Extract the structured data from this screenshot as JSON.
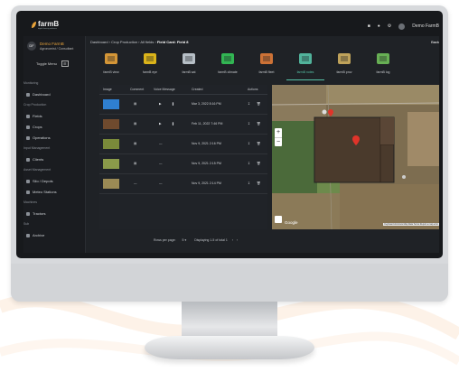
{
  "app": {
    "logo_text": "farmB",
    "logo_tagline": "digital farming solutions"
  },
  "user": {
    "initials": "DF",
    "name": "Demo FarmB",
    "role": "Agronomist / Consultant",
    "top_name": "Demo FarmB"
  },
  "sidebar": {
    "toggle_label": "Toggle Menu",
    "items": [
      {
        "label": "Monitoring",
        "type": "head"
      },
      {
        "label": "Dashboard",
        "type": "item"
      },
      {
        "label": "Crop Production",
        "type": "head"
      },
      {
        "label": "Fields",
        "type": "item"
      },
      {
        "label": "Crops",
        "type": "item"
      },
      {
        "label": "Operations",
        "type": "item"
      },
      {
        "label": "Input Management",
        "type": "head"
      },
      {
        "label": "Clients",
        "type": "item"
      },
      {
        "label": "Asset Management",
        "type": "head"
      },
      {
        "label": "Silo / Depots",
        "type": "item"
      },
      {
        "label": "Meteo Stations",
        "type": "item"
      },
      {
        "label": "Machines",
        "type": "head"
      },
      {
        "label": "Tractors",
        "type": "item"
      },
      {
        "label": "Sub",
        "type": "head"
      },
      {
        "label": "Archive",
        "type": "item"
      }
    ]
  },
  "breadcrumb": {
    "items": [
      "Dashboard",
      "Crop Production",
      "All fields"
    ],
    "current": "Field Card: Field 8",
    "back_label": "Back"
  },
  "tabs": [
    {
      "label": "farmB view",
      "icon": "pie-chart-icon",
      "active": false
    },
    {
      "label": "farmB eye",
      "icon": "drone-icon",
      "active": false
    },
    {
      "label": "farmB sat",
      "icon": "satellite-icon",
      "active": false
    },
    {
      "label": "farmB climate",
      "icon": "weather-signal-icon",
      "active": false
    },
    {
      "label": "farmB fleet",
      "icon": "tractor-icon",
      "active": false
    },
    {
      "label": "farmB notes",
      "icon": "field-notes-icon",
      "active": true
    },
    {
      "label": "farmB prov",
      "icon": "layers-icon",
      "active": false
    },
    {
      "label": "farmB log",
      "icon": "logbook-icon",
      "active": false
    }
  ],
  "notes_table": {
    "headers": [
      "Image",
      "Comment",
      "Voice Message",
      "Created",
      "Actions"
    ],
    "rows": [
      {
        "thumb": "#2f7fd0",
        "comment": "note-icon",
        "voice": "play",
        "created": "Mar 3, 2022 8:16 PM"
      },
      {
        "thumb": "#6f4a2e",
        "comment": "note-icon",
        "voice": "play",
        "created": "Feb 11, 2022 7:46 PM"
      },
      {
        "thumb": "#7a8a3a",
        "comment": "note-icon",
        "voice": "—",
        "created": "Nov 9, 2021 2:16 PM"
      },
      {
        "thumb": "#8a9a4a",
        "comment": "note-icon",
        "voice": "—",
        "created": "Nov 9, 2021 2:15 PM"
      },
      {
        "thumb": "#9b8a55",
        "comment": "—",
        "voice": "—",
        "created": "Nov 9, 2021 2:14 PM"
      }
    ],
    "pagination": {
      "rows_per_page_label": "Rows per page:",
      "rows_per_page_value": "5",
      "displaying": "Displaying 1-5 of total 1"
    }
  },
  "map": {
    "provider": "Google",
    "zoom_in": "+",
    "zoom_out": "−",
    "attribution": "Keyboard shortcuts  Map Data  Terms  Report a map error"
  }
}
